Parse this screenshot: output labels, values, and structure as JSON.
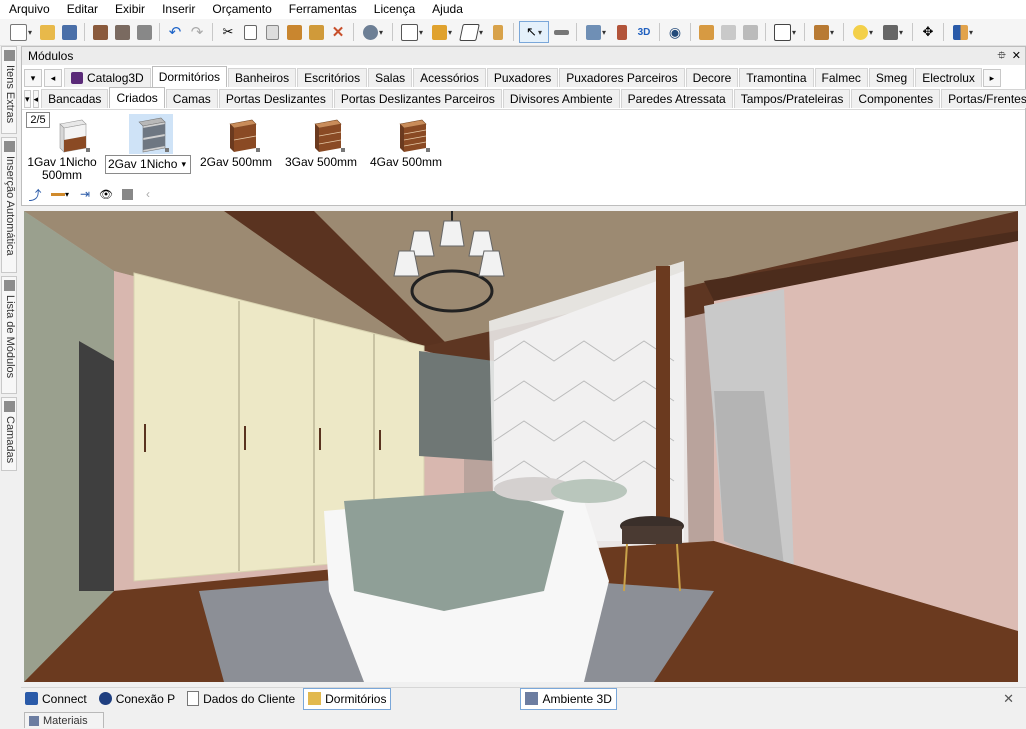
{
  "menu": [
    "Arquivo",
    "Editar",
    "Exibir",
    "Inserir",
    "Orçamento",
    "Ferramentas",
    "Licença",
    "Ajuda"
  ],
  "toolbar_icons": [
    "new-icon",
    "open-icon",
    "save-icon",
    "render-icon",
    "print-preview-icon",
    "print-icon",
    "undo-icon",
    "redo-icon",
    "cut-icon",
    "copy-icon",
    "paste-icon",
    "hammer-icon",
    "brush-icon",
    "delete-icon",
    "settings-icon",
    "group-icon",
    "align-icon",
    "shape-icon",
    "door-icon",
    "select-icon",
    "measure-icon",
    "layers-icon",
    "building-icon",
    "view-3d-icon",
    "eye-icon",
    "rotate-left-icon",
    "rotate-icon",
    "rotate-right-icon",
    "frame-icon",
    "box-icon",
    "light-icon",
    "camera-icon",
    "move-icon",
    "color-icon"
  ],
  "sidebar_tabs": [
    "Itens Extras",
    "Inserção Automática",
    "Lista de Módulos",
    "Camadas"
  ],
  "panel": {
    "title": "Módulos",
    "pin": "⯐",
    "close": "✕",
    "tabs_row1": [
      "Catalog3D",
      "Dormitórios",
      "Banheiros",
      "Escritórios",
      "Salas",
      "Acessórios",
      "Puxadores",
      "Puxadores Parceiros",
      "Decore",
      "Tramontina",
      "Falmec",
      "Smeg",
      "Electrolux"
    ],
    "active_tab_row1": "Dormitórios",
    "tabs_row2": [
      "Bancadas",
      "Criados",
      "Camas",
      "Portas Deslizantes",
      "Portas Deslizantes Parceiros",
      "Divisores Ambiente",
      "Paredes Atressata",
      "Tampos/Prateleiras",
      "Componentes",
      "Portas/Frentes"
    ],
    "active_tab_row2": "Criados",
    "page_counter": "2/5",
    "modules": [
      {
        "label": "1Gav 1Nicho 500mm"
      },
      {
        "label": "2Gav 1Nicho"
      },
      {
        "label": "2Gav 500mm"
      },
      {
        "label": "3Gav 500mm"
      },
      {
        "label": "4Gav 500mm"
      }
    ]
  },
  "bottom_tabs": [
    "Connect",
    "Conexão P",
    "Dados do Cliente",
    "Dormitórios",
    "Ambiente 3D"
  ],
  "active_bottom_tab": "Dormitórios",
  "footer_tab": "Materiais",
  "colors": {
    "accent": "#2b78c8",
    "panel_border": "#bdbdbd",
    "walnut": "#6b3a1f"
  }
}
